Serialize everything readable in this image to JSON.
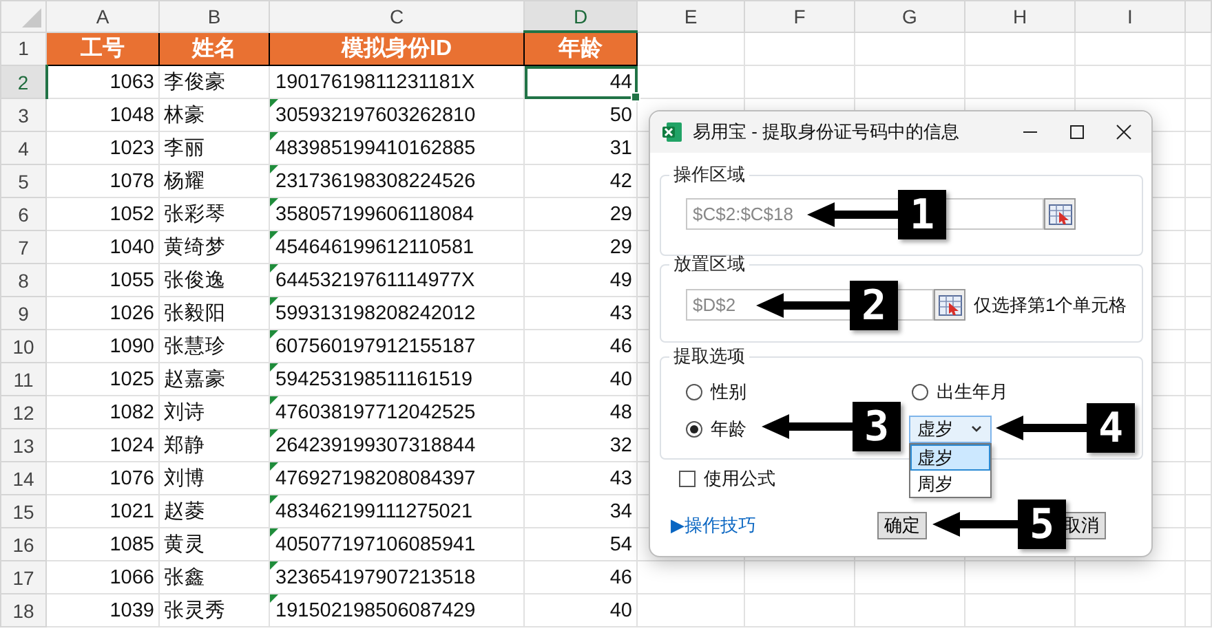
{
  "sheet": {
    "columns": [
      {
        "label": "A",
        "selected": false
      },
      {
        "label": "B",
        "selected": false
      },
      {
        "label": "C",
        "selected": false
      },
      {
        "label": "D",
        "selected": true
      },
      {
        "label": "E",
        "selected": false
      },
      {
        "label": "F",
        "selected": false
      },
      {
        "label": "G",
        "selected": false
      },
      {
        "label": "H",
        "selected": false
      },
      {
        "label": "I",
        "selected": false
      }
    ],
    "header_row": {
      "number": "1",
      "cells": [
        "工号",
        "姓名",
        "模拟身份ID",
        "年龄"
      ]
    },
    "rows": [
      {
        "number": "2",
        "id": "1063",
        "name": "李俊豪",
        "id_number": "19017619811231181X",
        "age": "44",
        "text_marker": false,
        "selected": true
      },
      {
        "number": "3",
        "id": "1048",
        "name": "林豪",
        "id_number": "305932197603262810",
        "age": "50",
        "text_marker": true,
        "selected": false
      },
      {
        "number": "4",
        "id": "1023",
        "name": "李丽",
        "id_number": "483985199410162885",
        "age": "31",
        "text_marker": true,
        "selected": false
      },
      {
        "number": "5",
        "id": "1078",
        "name": "杨耀",
        "id_number": "231736198308224526",
        "age": "42",
        "text_marker": true,
        "selected": false
      },
      {
        "number": "6",
        "id": "1052",
        "name": "张彩琴",
        "id_number": "358057199606118084",
        "age": "29",
        "text_marker": true,
        "selected": false
      },
      {
        "number": "7",
        "id": "1040",
        "name": "黄绮梦",
        "id_number": "454646199612110581",
        "age": "29",
        "text_marker": true,
        "selected": false
      },
      {
        "number": "8",
        "id": "1055",
        "name": "张俊逸",
        "id_number": "64453219761114977X",
        "age": "49",
        "text_marker": true,
        "selected": false
      },
      {
        "number": "9",
        "id": "1026",
        "name": "张毅阳",
        "id_number": "599313198208242012",
        "age": "43",
        "text_marker": true,
        "selected": false
      },
      {
        "number": "10",
        "id": "1090",
        "name": "张慧珍",
        "id_number": "607560197912155187",
        "age": "46",
        "text_marker": true,
        "selected": false
      },
      {
        "number": "11",
        "id": "1025",
        "name": "赵嘉豪",
        "id_number": "594253198511161519",
        "age": "40",
        "text_marker": true,
        "selected": false
      },
      {
        "number": "12",
        "id": "1082",
        "name": "刘诗",
        "id_number": "476038197712042525",
        "age": "48",
        "text_marker": true,
        "selected": false
      },
      {
        "number": "13",
        "id": "1024",
        "name": "郑静",
        "id_number": "264239199307318844",
        "age": "32",
        "text_marker": true,
        "selected": false
      },
      {
        "number": "14",
        "id": "1076",
        "name": "刘博",
        "id_number": "476927198208084397",
        "age": "43",
        "text_marker": true,
        "selected": false
      },
      {
        "number": "15",
        "id": "1021",
        "name": "赵菱",
        "id_number": "483462199111275021",
        "age": "34",
        "text_marker": true,
        "selected": false
      },
      {
        "number": "16",
        "id": "1085",
        "name": "黄灵",
        "id_number": "405077197106085941",
        "age": "54",
        "text_marker": true,
        "selected": false
      },
      {
        "number": "17",
        "id": "1066",
        "name": "张鑫",
        "id_number": "323654197907213518",
        "age": "46",
        "text_marker": true,
        "selected": false
      },
      {
        "number": "18",
        "id": "1039",
        "name": "张灵秀",
        "id_number": "191502198506087429",
        "age": "40",
        "text_marker": true,
        "selected": false
      }
    ]
  },
  "dialog": {
    "title": "易用宝 - 提取身份证号码中的信息",
    "operation_area": {
      "legend": "操作区域",
      "value": "$C$2:$C$18"
    },
    "output_area": {
      "legend": "放置区域",
      "value": "$D$2",
      "hint": "仅选择第1个单元格"
    },
    "extract_options": {
      "legend": "提取选项",
      "options": [
        {
          "label": "性别",
          "selected": false
        },
        {
          "label": "出生年月",
          "selected": false
        },
        {
          "label": "年龄",
          "selected": true
        }
      ],
      "age_type": {
        "value": "虚岁",
        "expanded": true,
        "options": [
          {
            "label": "虚岁",
            "selected": true
          },
          {
            "label": "周岁",
            "selected": false
          }
        ]
      }
    },
    "use_formula": {
      "label": "使用公式",
      "checked": false
    },
    "tips_link": "▶操作技巧",
    "buttons": [
      "确定",
      "取消"
    ]
  },
  "callouts": [
    "1",
    "2",
    "3",
    "4",
    "5"
  ]
}
